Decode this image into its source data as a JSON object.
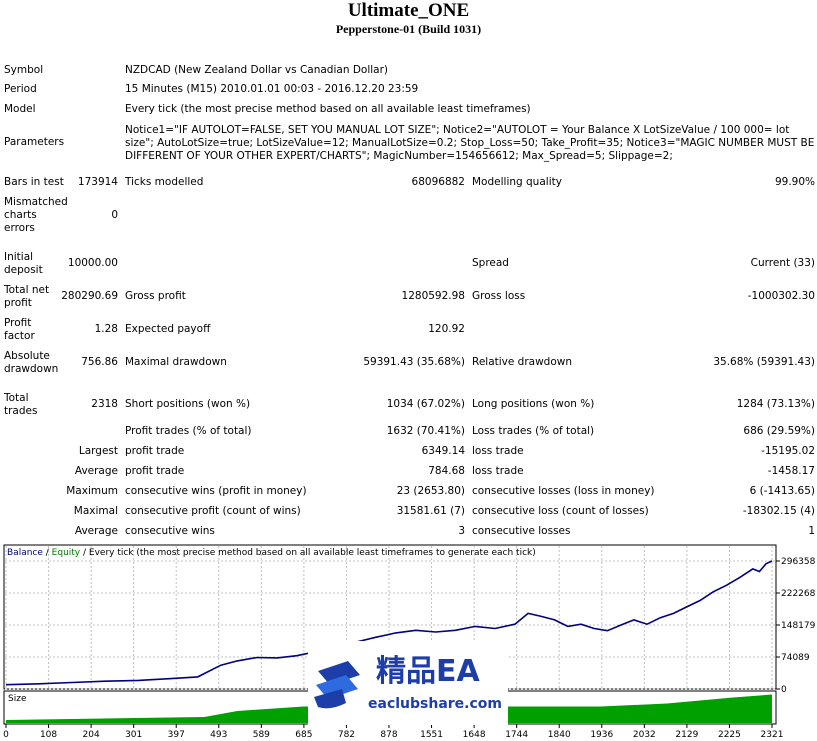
{
  "header": {
    "title": "Ultimate_ONE",
    "subtitle": "Pepperstone-01 (Build 1031)"
  },
  "report": {
    "symbol_label": "Symbol",
    "symbol_value": "NZDCAD (New Zealand Dollar vs Canadian Dollar)",
    "period_label": "Period",
    "period_value": "15 Minutes (M15) 2010.01.01 00:03 - 2016.12.20 23:59",
    "model_label": "Model",
    "model_value": "Every tick (the most precise method based on all available least timeframes)",
    "parameters_label": "Parameters",
    "parameters_value": "Notice1=\"IF AUTOLOT=FALSE, SET YOU MANUAL LOT SIZE\"; Notice2=\"AUTOLOT = Your Balance X LotSizeValue / 100 000= lot size\"; AutoLotSize=true; LotSizeValue=12; ManualLotSize=0.2; Stop_Loss=50; Take_Profit=35; Notice3=\"MAGIC NUMBER MUST BE DIFFERENT OF YOUR OTHER EXPERT/CHARTS\"; MagicNumber=154656612; Max_Spread=5; Slippage=2;",
    "bars_label": "Bars in test",
    "bars_value": "173914",
    "ticks_label": "Ticks modelled",
    "ticks_value": "68096882",
    "quality_label": "Modelling quality",
    "quality_value": "99.90%",
    "mismatch_label_1": "Mismatched",
    "mismatch_label_2": "charts",
    "mismatch_label_3": "errors",
    "mismatch_value": "0",
    "deposit_label_1": "Initial",
    "deposit_label_2": "deposit",
    "deposit_value": "10000.00",
    "spread_label": "Spread",
    "spread_value": "Current (33)",
    "net_label_1": "Total net",
    "net_label_2": "profit",
    "net_value": "280290.69",
    "gross_profit_label": "Gross profit",
    "gross_profit_value": "1280592.98",
    "gross_loss_label": "Gross loss",
    "gross_loss_value": "-1000302.30",
    "pf_label_1": "Profit",
    "pf_label_2": "factor",
    "pf_value": "1.28",
    "payoff_label": "Expected payoff",
    "payoff_value": "120.92",
    "abs_dd_label_1": "Absolute",
    "abs_dd_label_2": "drawdown",
    "abs_dd_value": "756.86",
    "max_dd_label": "Maximal drawdown",
    "max_dd_value": "59391.43 (35.68%)",
    "rel_dd_label": "Relative drawdown",
    "rel_dd_value": "35.68% (59391.43)",
    "trades_label_1": "Total",
    "trades_label_2": "trades",
    "trades_value": "2318",
    "short_label": "Short positions (won %)",
    "short_value": "1034 (67.02%)",
    "long_label": "Long positions (won %)",
    "long_value": "1284 (73.13%)",
    "profit_trades_label": "Profit trades (% of total)",
    "profit_trades_value": "1632 (70.41%)",
    "loss_trades_label": "Loss trades (% of total)",
    "loss_trades_value": "686 (29.59%)",
    "largest_label": "Largest",
    "largest_profit_label": "profit trade",
    "largest_profit_value": "6349.14",
    "largest_loss_label": "loss trade",
    "largest_loss_value": "-15195.02",
    "average_label": "Average",
    "average_profit_label": "profit trade",
    "average_profit_value": "784.68",
    "average_loss_label": "loss trade",
    "average_loss_value": "-1458.17",
    "maximum_label": "Maximum",
    "max_cons_wins_label": "consecutive wins (profit in money)",
    "max_cons_wins_value": "23 (2653.80)",
    "max_cons_losses_label": "consecutive losses (loss in money)",
    "max_cons_losses_value": "6 (-1413.65)",
    "maximal_label": "Maximal",
    "maximal_cons_profit_label": "consecutive profit (count of wins)",
    "maximal_cons_profit_value": "31581.61 (7)",
    "maximal_cons_loss_label": "consecutive loss (count of losses)",
    "maximal_cons_loss_value": "-18302.15 (4)",
    "avg2_label": "Average",
    "avg_cons_wins_label": "consecutive wins",
    "avg_cons_wins_value": "3",
    "avg_cons_losses_label": "consecutive losses",
    "avg_cons_losses_value": "1"
  },
  "watermark": {
    "brand": "精品EA",
    "url": "eaclubshare.com"
  },
  "chart_data": {
    "type": "line",
    "legend_balance": "Balance",
    "legend_equity": "Equity",
    "legend_rest": " / Every tick (the most precise method based on all available least timeframes to generate each tick)",
    "size_label": "Size",
    "y_ticks": [
      "296358",
      "222268",
      "148179",
      "74089",
      "0"
    ],
    "y_tick_values": [
      296358,
      222268,
      148179,
      74089,
      0
    ],
    "ylim": [
      0,
      296358
    ],
    "xlim": [
      0,
      2318
    ],
    "x_ticks": [
      "0",
      "108",
      "204",
      "301",
      "397",
      "493",
      "589",
      "685",
      "782",
      "878",
      "1551",
      "1648",
      "1744",
      "1840",
      "1936",
      "2032",
      "2129",
      "2225",
      "2321"
    ],
    "x_tick_values": [
      0,
      108,
      204,
      301,
      397,
      493,
      589,
      685,
      782,
      878,
      1551,
      1648,
      1744,
      1840,
      1936,
      2032,
      2129,
      2225,
      2321
    ],
    "balance_color": "#000080",
    "equity_color": "#008000",
    "size_color": "#00a000",
    "series": [
      {
        "name": "Balance",
        "x": [
          0,
          100,
          200,
          300,
          400,
          500,
          580,
          650,
          700,
          760,
          820,
          880,
          960,
          1040,
          1120,
          1180,
          1240,
          1300,
          1360,
          1420,
          1480,
          1540,
          1580,
          1620,
          1660,
          1700,
          1740,
          1780,
          1820,
          1860,
          1900,
          1940,
          1980,
          2020,
          2060,
          2100,
          2140,
          2180,
          2220,
          2260,
          2280,
          2300,
          2318
        ],
        "y": [
          10000,
          12000,
          15000,
          18000,
          20000,
          24000,
          28000,
          55000,
          65000,
          73000,
          72000,
          77000,
          90000,
          105000,
          120000,
          130000,
          136000,
          132000,
          136000,
          145000,
          140000,
          150000,
          175000,
          168000,
          160000,
          145000,
          150000,
          140000,
          135000,
          148000,
          160000,
          150000,
          165000,
          175000,
          190000,
          205000,
          225000,
          240000,
          258000,
          278000,
          272000,
          290000,
          296358
        ]
      }
    ],
    "size_fill": [
      {
        "x": 0,
        "v": 0.1
      },
      {
        "x": 600,
        "v": 0.2
      },
      {
        "x": 700,
        "v": 0.4
      },
      {
        "x": 900,
        "v": 0.55
      },
      {
        "x": 1500,
        "v": 0.55
      },
      {
        "x": 1800,
        "v": 0.55
      },
      {
        "x": 2000,
        "v": 0.65
      },
      {
        "x": 2200,
        "v": 0.85
      },
      {
        "x": 2318,
        "v": 0.95
      }
    ]
  }
}
